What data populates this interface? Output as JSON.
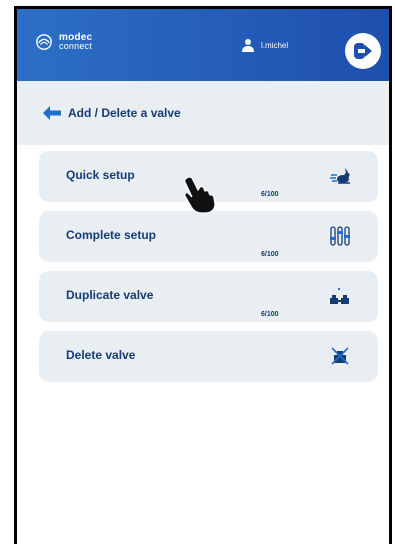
{
  "app": {
    "logo_top": "modec",
    "logo_bottom": "connect",
    "user_name": "l.michel"
  },
  "page": {
    "title": "Add / Delete a valve"
  },
  "actions": [
    {
      "label": "Quick setup",
      "count": "6/100",
      "icon": "rabbit-icon"
    },
    {
      "label": "Complete setup",
      "count": "6/100",
      "icon": "sliders-icon"
    },
    {
      "label": "Duplicate valve",
      "count": "6/100",
      "icon": "duplicate-valve-icon"
    },
    {
      "label": "Delete valve",
      "count": "",
      "icon": "delete-valve-icon"
    }
  ],
  "colors": {
    "header_start": "#2c6fc7",
    "header_end": "#1f4fae",
    "panel": "#e9eef3",
    "text": "#173b73"
  }
}
